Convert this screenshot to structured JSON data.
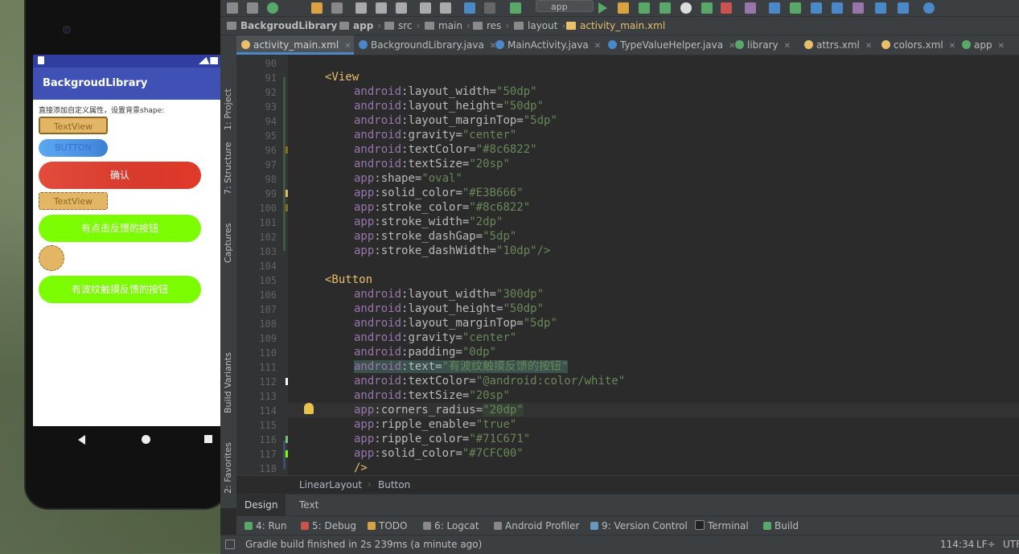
{
  "phone": {
    "app_title": "BackgroudLibrary",
    "description": "直接添加自定义属性，设置背景shape:",
    "textview1": "TextView",
    "button_blue": "BUTTON",
    "button_confirm": "确认",
    "textview2": "TextView",
    "button_feedback": "有点击反馈的按钮",
    "button_ripple": "有波纹触摸反馈的按钮"
  },
  "toolbar": {
    "run_config": "app"
  },
  "breadcrumbs": [
    "BackgroudLibrary",
    "app",
    "src",
    "main",
    "res",
    "layout",
    "activity_main.xml"
  ],
  "tabs": [
    {
      "label": "activity_main.xml",
      "color": "#e8bf6a"
    },
    {
      "label": "BackgroundLibrary.java",
      "color": "#4a88c7"
    },
    {
      "label": "MainActivity.java",
      "color": "#4a88c7"
    },
    {
      "label": "TypeValueHelper.java",
      "color": "#4a88c7"
    },
    {
      "label": "library",
      "color": "#59a869"
    },
    {
      "label": "attrs.xml",
      "color": "#e8bf6a"
    },
    {
      "label": "colors.xml",
      "color": "#e8bf6a"
    },
    {
      "label": "app",
      "color": "#59a869"
    }
  ],
  "left_tools": [
    "1: Project",
    "7: Structure",
    "Captures",
    "Build Variants",
    "2: Favorites"
  ],
  "code": {
    "line_numbers": [
      "90",
      "91",
      "92",
      "93",
      "94",
      "95",
      "96",
      "97",
      "98",
      "99",
      "100",
      "101",
      "102",
      "103",
      "104",
      "105",
      "106",
      "107",
      "108",
      "109",
      "110",
      "111",
      "112",
      "113",
      "114",
      "115",
      "116",
      "117",
      "118"
    ],
    "tag_view": "<View",
    "tag_button": "<Button",
    "end_tag": "/>",
    "view_attrs": [
      {
        "ns": "android",
        "name": ":layout_width=",
        "val": "\"50dp\""
      },
      {
        "ns": "android",
        "name": ":layout_height=",
        "val": "\"50dp\""
      },
      {
        "ns": "android",
        "name": ":layout_marginTop=",
        "val": "\"5dp\""
      },
      {
        "ns": "android",
        "name": ":gravity=",
        "val": "\"center\""
      },
      {
        "ns": "android",
        "name": ":textColor=",
        "val": "\"#8c6822\""
      },
      {
        "ns": "android",
        "name": ":textSize=",
        "val": "\"20sp\""
      },
      {
        "ns": "app",
        "name": ":shape=",
        "val": "\"oval\""
      },
      {
        "ns": "app",
        "name": ":solid_color=",
        "val": "\"#E3B666\""
      },
      {
        "ns": "app",
        "name": ":stroke_color=",
        "val": "\"#8c6822\""
      },
      {
        "ns": "app",
        "name": ":stroke_width=",
        "val": "\"2dp\""
      },
      {
        "ns": "app",
        "name": ":stroke_dashGap=",
        "val": "\"5dp\""
      },
      {
        "ns": "app",
        "name": ":stroke_dashWidth=",
        "val": "\"10dp\"/>"
      }
    ],
    "button_attrs": [
      {
        "ns": "android",
        "name": ":layout_width=",
        "val": "\"300dp\""
      },
      {
        "ns": "android",
        "name": ":layout_height=",
        "val": "\"50dp\""
      },
      {
        "ns": "android",
        "name": ":layout_marginTop=",
        "val": "\"5dp\""
      },
      {
        "ns": "android",
        "name": ":gravity=",
        "val": "\"center\""
      },
      {
        "ns": "android",
        "name": ":padding=",
        "val": "\"0dp\""
      },
      {
        "ns": "android",
        "name": ":text=",
        "val": "\"有波纹触摸反馈的按钮\""
      },
      {
        "ns": "android",
        "name": ":textColor=",
        "val": "\"@android:color/white\""
      },
      {
        "ns": "android",
        "name": ":textSize=",
        "val": "\"20sp\""
      },
      {
        "ns": "app",
        "name": ":corners_radius=",
        "val": "\"20dp\""
      },
      {
        "ns": "app",
        "name": ":ripple_enable=",
        "val": "\"true\""
      },
      {
        "ns": "app",
        "name": ":ripple_color=",
        "val": "\"#71C671\""
      },
      {
        "ns": "app",
        "name": ":solid_color=",
        "val": "\"#7CFC00\""
      }
    ]
  },
  "path_bar": {
    "a": "LinearLayout",
    "b": "Button"
  },
  "design_tabs": {
    "design": "Design",
    "text": "Text"
  },
  "tool_windows": [
    {
      "label": "4: Run",
      "color": "#59a869"
    },
    {
      "label": "5: Debug",
      "color": "#c75450"
    },
    {
      "label": "TODO",
      "color": "#d9a343"
    },
    {
      "label": "6: Logcat",
      "color": "#bbbbbb"
    },
    {
      "label": "Android Profiler",
      "color": "#bbbbbb"
    },
    {
      "label": "9: Version Control",
      "color": "#6897bb"
    },
    {
      "label": "Terminal",
      "color": "#bbbbbb"
    },
    {
      "label": "Build",
      "color": "#59a869"
    }
  ],
  "status": {
    "message": "Gradle build finished in 2s 239ms (a minute ago)",
    "position": "114:34",
    "line_sep": "LF÷",
    "encoding": "UTF"
  }
}
